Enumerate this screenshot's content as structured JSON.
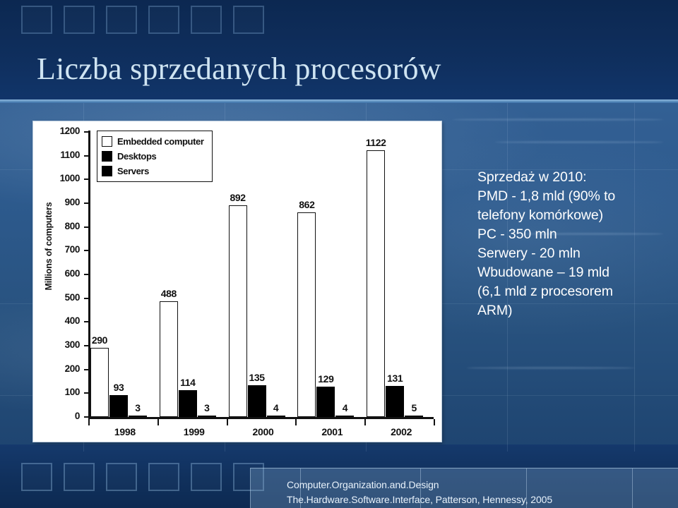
{
  "slide": {
    "title": "Liczba sprzedanych procesorów",
    "decor_squares_top": 6,
    "decor_squares_bottom": 6,
    "colors": {
      "title_text": "#cfe4f2",
      "background_top": "#0e2d5b",
      "background_mid": "#2d5a8d",
      "divider": "#9cc4e6",
      "body_text": "#ffffff",
      "footer_text": "#e8f2fb"
    }
  },
  "side_note": {
    "lines": [
      "Sprzedaż w 2010:",
      "PMD - 1,8 mld (90% to",
      "telefony komórkowe)",
      "PC - 350 mln",
      "Serwery - 20 mln",
      "Wbudowane – 19 mld",
      "(6,1 mld z procesorem",
      "ARM)"
    ]
  },
  "footer": {
    "line1": "Computer.Organization.and.Design",
    "line2": "The.Hardware.Software.Interface, Patterson, Hennessy, 2005"
  },
  "chart_data": {
    "type": "bar",
    "title": "",
    "xlabel": "",
    "ylabel": "Millions of computers",
    "ylim": [
      0,
      1200
    ],
    "ytick_step": 100,
    "yticks": [
      0,
      100,
      200,
      300,
      400,
      500,
      600,
      700,
      800,
      900,
      1000,
      1100,
      1200
    ],
    "ytick_labels": [
      "0",
      "100",
      "200",
      "300",
      "400",
      "500",
      "600",
      "700",
      "800",
      "900",
      "1000",
      "1100",
      "1200"
    ],
    "categories": [
      "1998",
      "1999",
      "2000",
      "2001",
      "2002"
    ],
    "grid": false,
    "legend_position": "top-left",
    "series": [
      {
        "name": "Embedded computer",
        "fill": "#ffffff",
        "stroke": "#111111",
        "values": [
          290,
          488,
          892,
          862,
          1122
        ]
      },
      {
        "name": "Desktops",
        "fill": "#000000",
        "stroke": "#000000",
        "values": [
          93,
          114,
          135,
          129,
          131
        ]
      },
      {
        "name": "Servers",
        "fill": "#000000",
        "stroke": "#000000",
        "values": [
          3,
          3,
          4,
          4,
          5
        ]
      }
    ]
  }
}
